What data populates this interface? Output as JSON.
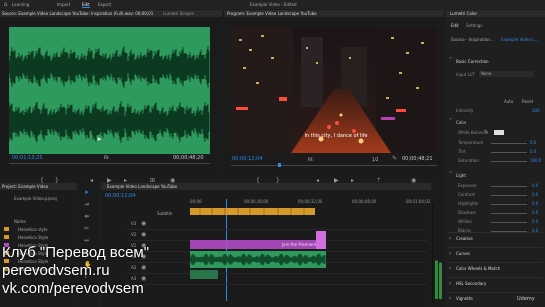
{
  "app": {
    "menu": [
      "Learning",
      "Import",
      "Edit",
      "Export"
    ],
    "active_menu": "Edit",
    "doc_title": "Example Video - Edited",
    "home_icon": "home-icon"
  },
  "source_panel": {
    "tabs": [
      "Source: Example Video Landscape YouTube: Inspiration (Full).wav: 00;00;01",
      "Lumetri Scopes"
    ],
    "timecode_left": "00;01;13;25",
    "timecode_right": "00;00;48;20",
    "zoom": "Fit"
  },
  "program_panel": {
    "title": "Program: Example Video Landscape YouTube",
    "subtitle": "In this city, I dance of life",
    "timecode_left": "00;00;12;04",
    "timecode_right": "00;00;48;21",
    "zoom": "Fit",
    "resolution": "1/2"
  },
  "project_panel": {
    "title": "Project: Example Video",
    "file": "Example Video.prproj",
    "column": "Name",
    "items": [
      "Helvetica style",
      "Helvetica Style",
      "Helvetica Style",
      "Helvetica Style",
      "Helvetica Style",
      "Maya Rebel Sans"
    ]
  },
  "timeline": {
    "title": "Example Video Landscape YouTube",
    "timecode": "00;00;12;04",
    "subtitle_track": "Subtitle",
    "ruler": [
      "00;00",
      "00;00;16;00",
      "00;00;32;00",
      "00;00;48;00",
      "00;01;04;02"
    ],
    "tracks": [
      "V3",
      "V2",
      "V1",
      "A1",
      "A2",
      "A3"
    ],
    "clip_label": "Join the Premiere"
  },
  "lumetri": {
    "title": "Lumetri Color",
    "tabs": [
      "Edit",
      "Settings"
    ],
    "source": "Source - Inspiration…",
    "target": "Example Video L…",
    "sections": [
      "Basic Correction",
      "Creative",
      "Curves",
      "Color Wheels & Match",
      "HSL Secondary",
      "Vignette"
    ],
    "basic": {
      "input_lut_label": "Input LUT",
      "input_lut_value": "None",
      "intensity_label": "Intensity",
      "intensity_value": "100",
      "auto_label": "Auto",
      "reset_label": "Reset",
      "color_section": "Color",
      "white_balance_label": "White Balance",
      "color_rows": [
        {
          "label": "Temperature",
          "value": "0.0"
        },
        {
          "label": "Tint",
          "value": "0.0"
        },
        {
          "label": "Saturation",
          "value": "100.0"
        }
      ],
      "light_section": "Light",
      "light_rows": [
        {
          "label": "Exposure",
          "value": "0.0"
        },
        {
          "label": "Contrast",
          "value": "0.0"
        },
        {
          "label": "Highlights",
          "value": "0.0"
        },
        {
          "label": "Shadows",
          "value": "0.0"
        },
        {
          "label": "Whites",
          "value": "0.0"
        },
        {
          "label": "Blacks",
          "value": "0.0"
        }
      ]
    }
  },
  "watermark": {
    "lines": [
      "Клуб \"Перевод всем\"",
      "perevodvsem.ru",
      "vk.com/perevodvsem"
    ],
    "brand": "Udemy"
  },
  "colors": {
    "waveform_bg": "#2f9a5d",
    "waveform": "#0b3a20",
    "accent_blue": "#2d8ceb",
    "clip_orange": "#d69a2a",
    "clip_purple": "#b14ac7",
    "audio_green": "#2f9a5d"
  }
}
